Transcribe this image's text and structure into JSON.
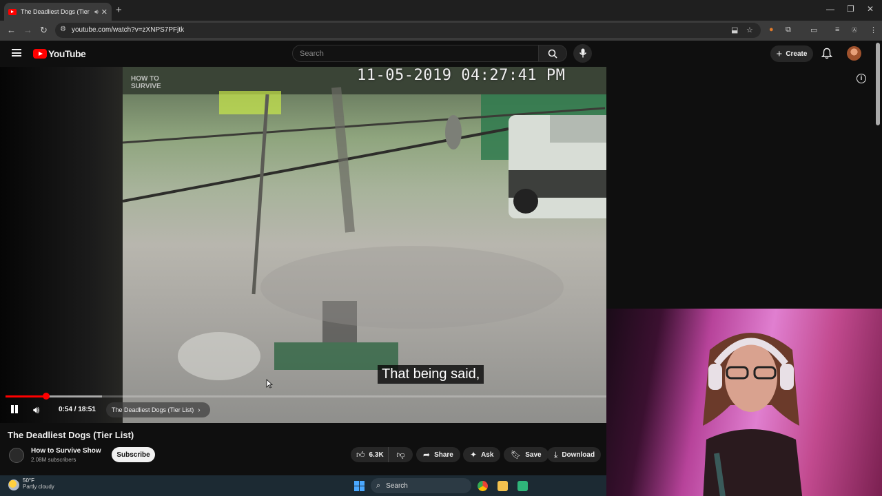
{
  "browser": {
    "tab_title": "The Deadliest Dogs (Tier List)",
    "new_tab": "+",
    "url": "youtube.com/watch?v=zXNPS7PFjtk"
  },
  "youtube": {
    "logo_text": "YouTube",
    "search_placeholder": "Search",
    "create_label": "Create"
  },
  "video": {
    "timestamp_overlay": "11-05-2019 04:27:41 PM",
    "watermark": "HOW TO SURVIVE",
    "caption": "That being said,",
    "time_display": "0:54 / 18:51",
    "chapter": "The Deadliest Dogs (Tier List)",
    "progress_fraction": 0.068,
    "buffer_fraction": 0.16
  },
  "details": {
    "title": "The Deadliest Dogs (Tier List)",
    "channel_name": "How to Survive Show",
    "subscribers": "2.08M subscribers",
    "subscribe_label": "Subscribe",
    "like_count": "6.3K",
    "share_label": "Share",
    "ask_label": "Ask",
    "save_label": "Save",
    "download_label": "Download"
  },
  "taskbar": {
    "temperature": "50°F",
    "condition": "Partly cloudy",
    "search_label": "Search"
  },
  "colors": {
    "brand_red": "#ff0000",
    "background": "#0f0f0f"
  }
}
